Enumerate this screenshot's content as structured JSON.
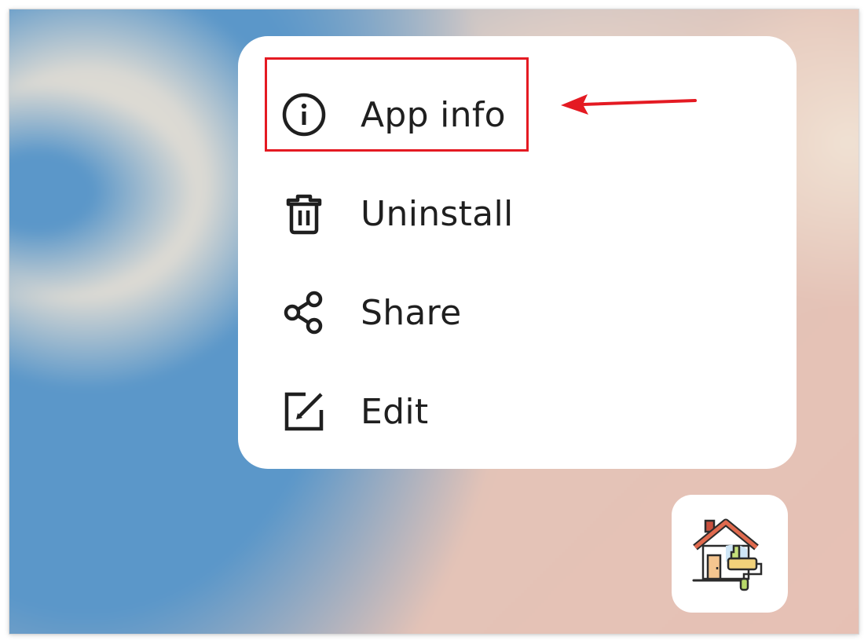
{
  "menu": {
    "items": [
      {
        "label": "App info",
        "icon": "info-icon"
      },
      {
        "label": "Uninstall",
        "icon": "trash-icon"
      },
      {
        "label": "Share",
        "icon": "share-icon"
      },
      {
        "label": "Edit",
        "icon": "edit-icon"
      }
    ]
  },
  "annotation": {
    "color": "#e41a22"
  },
  "app": {
    "icon": "house-painting-icon"
  },
  "colors": {
    "menu_text": "#1f1f1f",
    "menu_background": "#ffffff",
    "wallpaper_blue": "#5b97c9",
    "wallpaper_pink": "#e6c0b4"
  }
}
